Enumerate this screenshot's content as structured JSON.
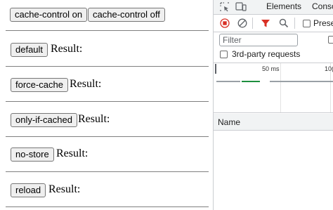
{
  "page": {
    "top_buttons": {
      "cache_on": "cache-control on",
      "cache_off": "cache-control off"
    },
    "result_label": "Result:",
    "rows": [
      {
        "button": "default"
      },
      {
        "button": "force-cache"
      },
      {
        "button": "only-if-cached"
      },
      {
        "button": "no-store"
      },
      {
        "button": "reload"
      }
    ]
  },
  "devtools": {
    "tabs": [
      "Elements",
      "Consc"
    ],
    "preserve_log_label": "Prese",
    "filter_placeholder": "Filter",
    "third_party_label": "3rd-party requests",
    "timeline_ticks": [
      "50 ms",
      "10("
    ],
    "name_column": "Name",
    "colors": {
      "record": "#d93025",
      "filter_funnel": "#d93025",
      "bar_green": "#1e8e3e",
      "bar_gray": "#9aa0a6"
    }
  }
}
